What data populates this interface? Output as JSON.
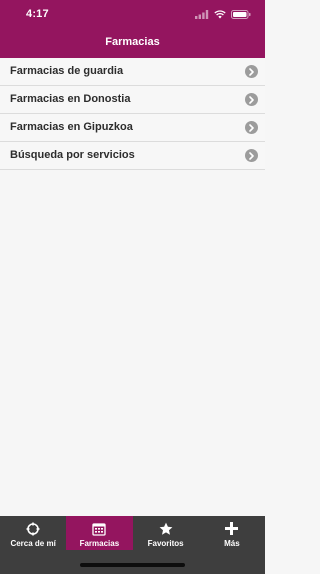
{
  "status_bar": {
    "time": "4:17"
  },
  "nav": {
    "title": "Farmacias"
  },
  "menu": {
    "items": [
      {
        "label": "Farmacias de guardia"
      },
      {
        "label": "Farmacias en Donostia"
      },
      {
        "label": "Farmacias en Gipuzkoa"
      },
      {
        "label": "Búsqueda por servicios"
      }
    ]
  },
  "tabs": [
    {
      "label": "Cerca de mí",
      "icon": "crosshair-icon",
      "active": false
    },
    {
      "label": "Farmacias",
      "icon": "calendar-icon",
      "active": true
    },
    {
      "label": "Favoritos",
      "icon": "star-icon",
      "active": false
    },
    {
      "label": "Más",
      "icon": "plus-icon",
      "active": false
    }
  ],
  "colors": {
    "brand": "#94155f",
    "tab_bar": "#3e3e3e",
    "chevron": "#9c9c9c"
  }
}
